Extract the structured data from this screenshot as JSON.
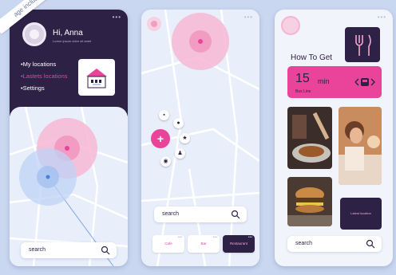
{
  "badge": {
    "text": "age inclus"
  },
  "screen1": {
    "greeting": "Hi, Anna",
    "subtitle": "Lorem ipsum dolor sit amet",
    "menu": [
      "•My locations",
      "•Lastets locations",
      "•Settings"
    ],
    "search_label": "search"
  },
  "screen2": {
    "search_label": "search",
    "chips": [
      "Cafe",
      "Bar",
      "Restaurant"
    ]
  },
  "screen3": {
    "title": "How To Get",
    "route_value": "15",
    "route_unit": "min",
    "route_sub": "Bus Line",
    "more_label": "Latest location",
    "search_label": "search"
  },
  "colors": {
    "accent": "#e9449a",
    "dark": "#2d2146",
    "background": "#c9d7f0"
  }
}
